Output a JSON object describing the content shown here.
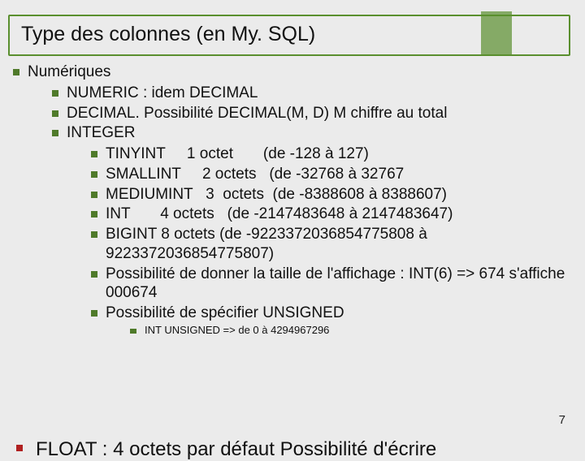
{
  "title": "Type des colonnes (en My. SQL)",
  "page_number": "7",
  "lvl1": {
    "label": "Numériques"
  },
  "lvl2": {
    "a": "NUMERIC : idem DECIMAL",
    "b": "DECIMAL. Possibilité DECIMAL(M, D) M chiffre au total",
    "c": "INTEGER"
  },
  "lvl3": {
    "a": "TINYINT     1 octet       (de -128 à 127)",
    "b": "SMALLINT     2 octets   (de -32768 à 32767",
    "c": "MEDIUMINT   3  octets  (de -8388608 à 8388607)",
    "d": "INT       4 octets   (de -2147483648 à 2147483647)",
    "e": "BIGINT        8 octets   (de -9223372036854775808 à 9223372036854775807)",
    "f": "Possibilité de donner la taille de l'affichage : INT(6) => 674 s'affiche 000674",
    "g": "Possibilité de spécifier UNSIGNED"
  },
  "lvl4": {
    "a": "INT UNSIGNED => de 0 à 4294967296"
  },
  "cutoff": "FLOAT : 4 octets par défaut  Possibilité d'écrire"
}
